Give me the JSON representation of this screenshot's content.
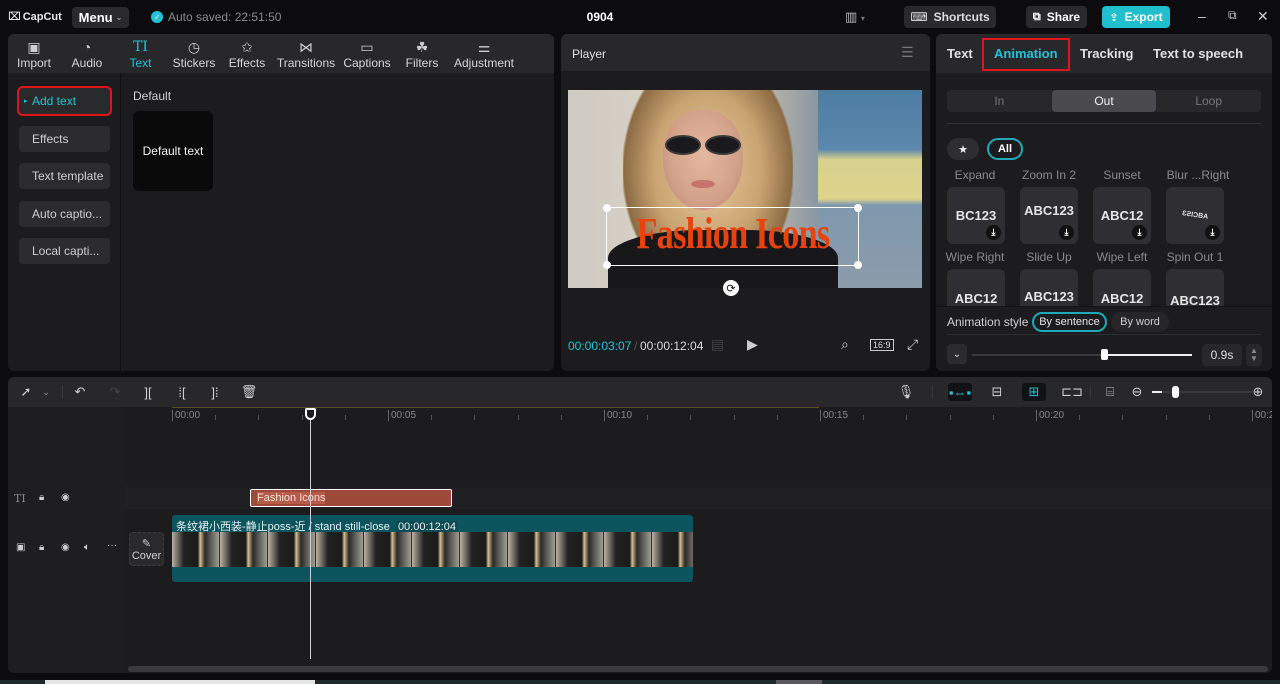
{
  "titlebar": {
    "app_name": "CapCut",
    "menu_label": "Menu",
    "autosave_text": "Auto saved: 22:51:50",
    "project_title": "0904",
    "shortcuts_label": "Shortcuts",
    "share_label": "Share",
    "export_label": "Export",
    "accent_color": "#22c3d6"
  },
  "media_toolbar": {
    "items": [
      {
        "label": "Import",
        "icon": "import-icon"
      },
      {
        "label": "Audio",
        "icon": "audio-icon"
      },
      {
        "label": "Text",
        "icon": "text-icon",
        "active": true
      },
      {
        "label": "Stickers",
        "icon": "stickers-icon"
      },
      {
        "label": "Effects",
        "icon": "effects-icon"
      },
      {
        "label": "Transitions",
        "icon": "transitions-icon"
      },
      {
        "label": "Captions",
        "icon": "captions-icon"
      },
      {
        "label": "Filters",
        "icon": "filters-icon"
      },
      {
        "label": "Adjustment",
        "icon": "adjustment-icon"
      }
    ]
  },
  "text_sidebar": {
    "items": [
      {
        "label": "Add text",
        "active": true
      },
      {
        "label": "Effects"
      },
      {
        "label": "Text template"
      },
      {
        "label": "Auto captio..."
      },
      {
        "label": "Local capti..."
      }
    ]
  },
  "text_library": {
    "section_label": "Default",
    "card_label": "Default text"
  },
  "player": {
    "title": "Player",
    "overlay_text": "Fashion Icons",
    "current_time": "00:00:03:07",
    "total_time": "00:00:12:04",
    "aspect_ratio": "16:9"
  },
  "inspector": {
    "tabs": [
      {
        "label": "Text"
      },
      {
        "label": "Animation",
        "active": true
      },
      {
        "label": "Tracking"
      },
      {
        "label": "Text to speech"
      }
    ],
    "segments": [
      {
        "label": "In"
      },
      {
        "label": "Out",
        "active": true
      },
      {
        "label": "Loop"
      }
    ],
    "filter_all": "All",
    "animations_row1": [
      {
        "label": "Expand",
        "preview": "BC123"
      },
      {
        "label": "Zoom In 2",
        "preview": "ABC123"
      },
      {
        "label": "Sunset",
        "preview": "ABC12"
      },
      {
        "label": "Blur ...Right",
        "preview": "ƐƧIƆBA"
      }
    ],
    "animations_row2": [
      {
        "label": "Wipe Right",
        "preview": "ABC12"
      },
      {
        "label": "Slide Up",
        "preview": "ABC123"
      },
      {
        "label": "Wipe Left",
        "preview": "ABC12"
      },
      {
        "label": "Spin Out 1",
        "preview": "ABC123"
      }
    ],
    "animation_style_label": "Animation style",
    "style_options": [
      {
        "label": "By sentence",
        "active": true
      },
      {
        "label": "By word"
      }
    ],
    "duration_value": "0.9s",
    "duration_fraction": 0.6
  },
  "timeline": {
    "ruler_labels": [
      "00:00",
      "00:05",
      "00:10",
      "00:15",
      "00:20",
      "00:2"
    ],
    "text_clip_label": "Fashion Icons",
    "text_clip_color": "#9e4a3a",
    "video_clip_label": "条纹裙小西装-静止poss-近 / stand still-close",
    "video_clip_duration": "00:00:12:04",
    "video_clip_color": "#0c555e",
    "cover_label": "Cover",
    "zoom_fraction": 0.1
  }
}
